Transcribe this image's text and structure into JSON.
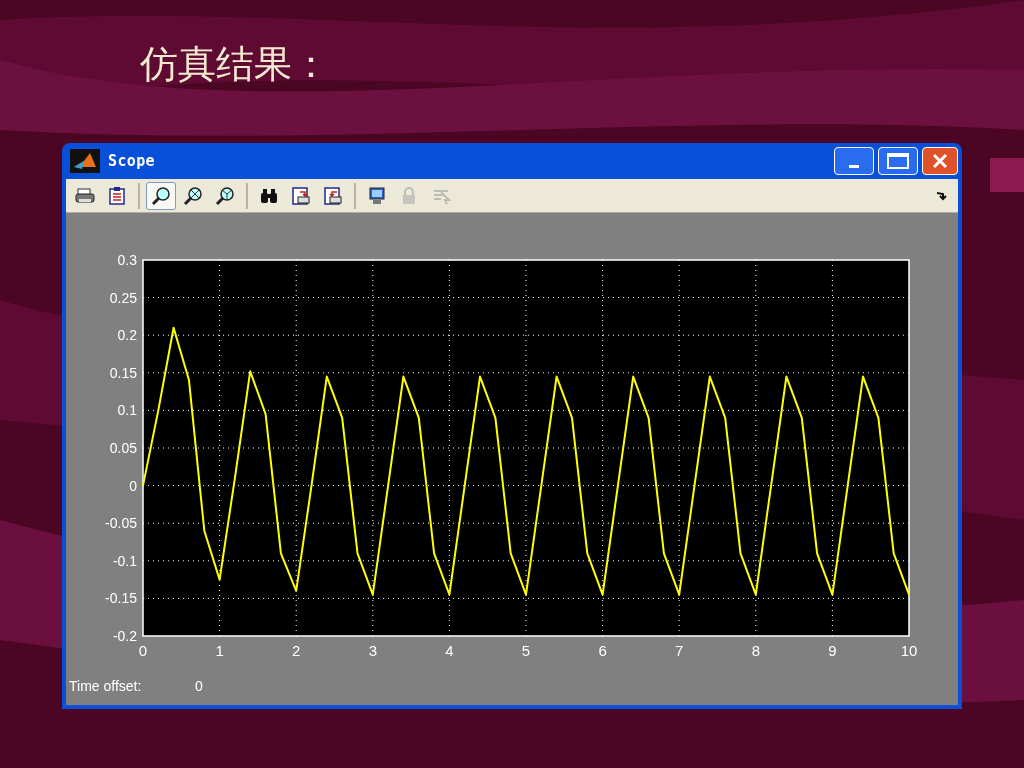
{
  "slide": {
    "title": "仿真结果："
  },
  "window": {
    "title": "Scope"
  },
  "toolbar": [
    {
      "kind": "print",
      "selected": false,
      "disabled": false
    },
    {
      "kind": "properties",
      "selected": false,
      "disabled": false
    },
    {
      "kind": "separator"
    },
    {
      "kind": "zoom",
      "selected": true,
      "disabled": false
    },
    {
      "kind": "zoomx",
      "selected": false,
      "disabled": false
    },
    {
      "kind": "zoomy",
      "selected": false,
      "disabled": false
    },
    {
      "kind": "separator"
    },
    {
      "kind": "autoscale",
      "selected": false,
      "disabled": false
    },
    {
      "kind": "saveaxes",
      "selected": false,
      "disabled": false
    },
    {
      "kind": "restoreaxes",
      "selected": false,
      "disabled": false
    },
    {
      "kind": "separator"
    },
    {
      "kind": "floating",
      "selected": false,
      "disabled": false
    },
    {
      "kind": "lock",
      "selected": false,
      "disabled": true
    },
    {
      "kind": "selector",
      "selected": false,
      "disabled": true
    }
  ],
  "plot": {
    "chart_data": {
      "type": "line",
      "xlim": [
        0,
        10
      ],
      "ylim": [
        -0.2,
        0.3
      ],
      "xticks": [
        0,
        1,
        2,
        3,
        4,
        5,
        6,
        7,
        8,
        9,
        10
      ],
      "grid": true,
      "yticks": [
        -0.2,
        -0.15,
        -0.1,
        -0.05,
        0,
        0.05,
        0.1,
        0.15,
        0.2,
        0.25,
        0.3
      ],
      "x": [
        0,
        0.2,
        0.4,
        0.6,
        0.8,
        1,
        1.2,
        1.4,
        1.6,
        1.8,
        2,
        2.2,
        2.4,
        2.6,
        2.8,
        3,
        3.2,
        3.4,
        3.6,
        3.8,
        4,
        4.2,
        4.4,
        4.6,
        4.8,
        5,
        5.2,
        5.4,
        5.6,
        5.8,
        6,
        6.2,
        6.4,
        6.6,
        6.8,
        7,
        7.2,
        7.4,
        7.6,
        7.8,
        8,
        8.2,
        8.4,
        8.6,
        8.8,
        9,
        9.2,
        9.4,
        9.6,
        9.8,
        10
      ],
      "series": [
        {
          "color": "#ffff00",
          "values": [
            0,
            0.1,
            0.21,
            0.14,
            -0.06,
            -0.125,
            0.01,
            0.152,
            0.095,
            -0.09,
            -0.14,
            0,
            0.145,
            0.09,
            -0.09,
            -0.145,
            0,
            0.145,
            0.09,
            -0.09,
            -0.145,
            0,
            0.145,
            0.09,
            -0.09,
            -0.145,
            0,
            0.145,
            0.09,
            -0.09,
            -0.145,
            0,
            0.145,
            0.09,
            -0.09,
            -0.145,
            0,
            0.145,
            0.09,
            -0.09,
            -0.145,
            0,
            0.145,
            0.09,
            -0.09,
            -0.145,
            0,
            0.145,
            0.09,
            -0.09,
            -0.145
          ]
        }
      ]
    }
  },
  "status": {
    "label": "Time offset:",
    "value": "0"
  }
}
